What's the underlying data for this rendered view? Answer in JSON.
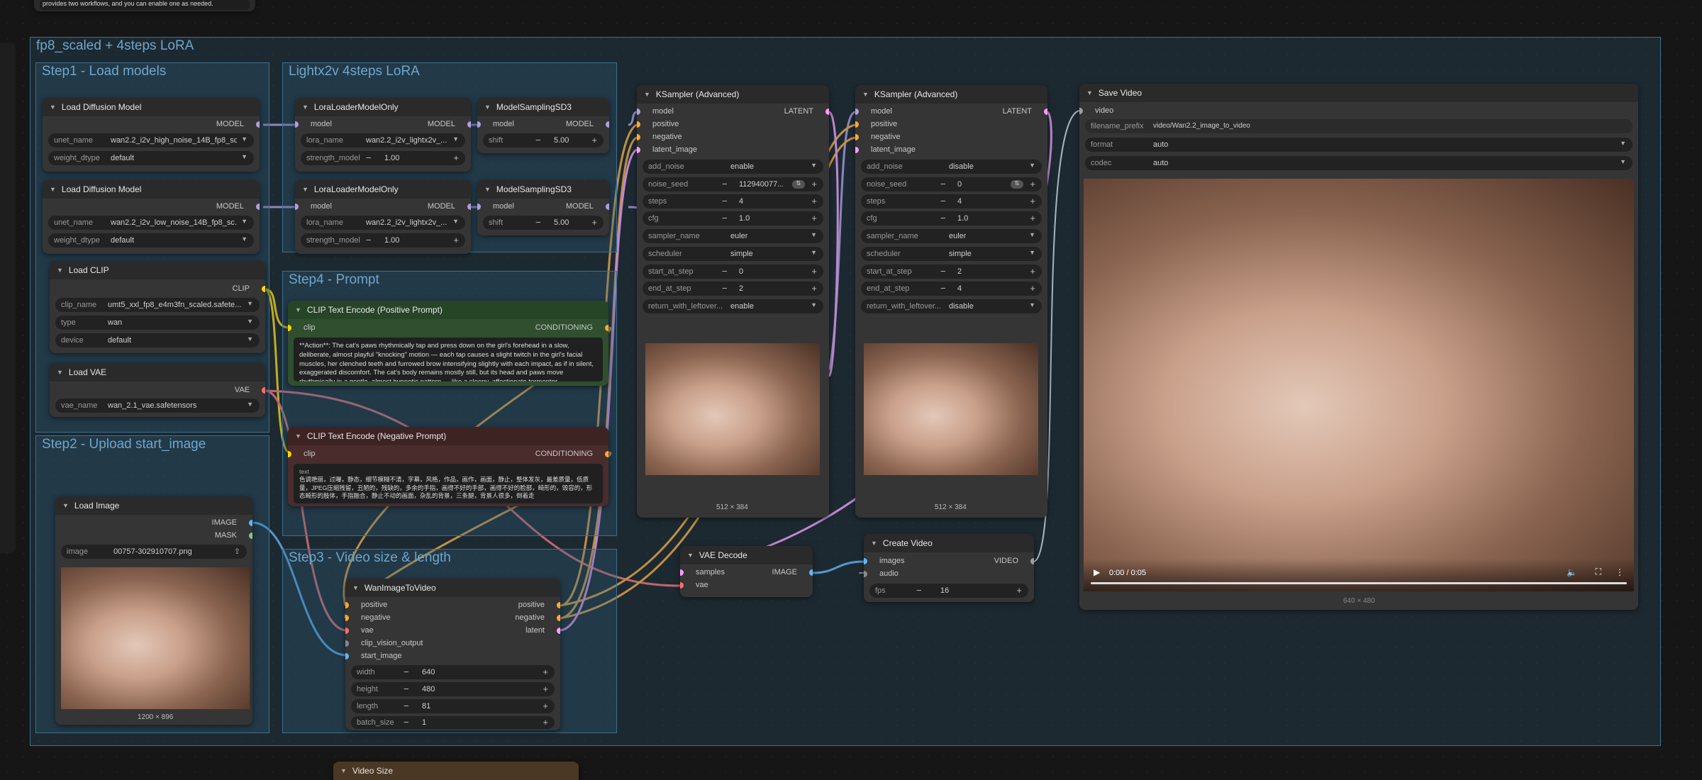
{
  "top_note": "provides two workflows, and you can enable one as needed.",
  "groups": {
    "main": "fp8_scaled +  4steps LoRA",
    "step1": "Step1 - Load models",
    "lightx": "Lightx2v 4steps LoRA",
    "step4": "Step4 - Prompt",
    "step2": "Step2 - Upload start_image",
    "step3": "Step3 - Video size & length"
  },
  "ldm1": {
    "title": "Load Diffusion Model",
    "out": "MODEL",
    "unet_label": "unet_name",
    "unet": "wan2.2_i2v_high_noise_14B_fp8_sc...",
    "wd_label": "weight_dtype",
    "wd": "default"
  },
  "ldm2": {
    "title": "Load Diffusion Model",
    "out": "MODEL",
    "unet_label": "unet_name",
    "unet": "wan2.2_i2v_low_noise_14B_fp8_sc...",
    "wd_label": "weight_dtype",
    "wd": "default"
  },
  "clip": {
    "title": "Load CLIP",
    "out": "CLIP",
    "name_label": "clip_name",
    "name": "umt5_xxl_fp8_e4m3fn_scaled.safete...",
    "type_label": "type",
    "type": "wan",
    "device_label": "device",
    "device": "default"
  },
  "vae": {
    "title": "Load VAE",
    "out": "VAE",
    "name_label": "vae_name",
    "name": "wan_2.1_vae.safetensors"
  },
  "lora1": {
    "title": "LoraLoaderModelOnly",
    "in": "model",
    "out": "MODEL",
    "name_label": "lora_name",
    "name": "wan2.2_i2v_lightx2v_...",
    "sm_label": "strength_model",
    "sm": "1.00"
  },
  "lora2": {
    "title": "LoraLoaderModelOnly",
    "in": "model",
    "out": "MODEL",
    "name_label": "lora_name",
    "name": "wan2.2_i2v_lightx2v_...",
    "sm_label": "strength_model",
    "sm": "1.00"
  },
  "msd1": {
    "title": "ModelSamplingSD3",
    "in": "model",
    "out": "MODEL",
    "shift_label": "shift",
    "shift": "5.00"
  },
  "msd2": {
    "title": "ModelSamplingSD3",
    "in": "model",
    "out": "MODEL",
    "shift_label": "shift",
    "shift": "5.00"
  },
  "pos": {
    "title": "CLIP Text Encode (Positive Prompt)",
    "in": "clip",
    "out": "CONDITIONING",
    "text": "**Action**: The cat's paws rhythmically tap and press down on the girl's forehead in a slow, deliberate, almost playful \"knocking\" motion — each tap causes a slight twitch in the girl's facial muscles, her clenched teeth and furrowed brow intensifying slightly with each impact, as if in silent, exaggerated discomfort. The cat's body remains mostly still, but its head and paws move rhythmically in a gentle, almost hypnotic pattern — like a sleepy, affectionate tormentor."
  },
  "neg": {
    "title": "CLIP Text Encode (Negative Prompt)",
    "in": "clip",
    "out": "CONDITIONING",
    "text_label": "text",
    "text": "色调艳丽，过曝，静态，细节模糊不清，字幕，风格，作品，画作，画面，静止，整体发灰，最差质量，低质量，JPEG压缩残留，丑陋的，残缺的，多余的手指，画得不好的手部，画得不好的脸部，畸形的，毁容的，形态畸形的肢体，手指融合，静止不动的画面，杂乱的背景，三条腿，背景人很多，倒着走"
  },
  "loadimg": {
    "title": "Load Image",
    "out_image": "IMAGE",
    "out_mask": "MASK",
    "image_label": "image",
    "image": "00757-302910707.png",
    "size": "1200 × 896"
  },
  "wan": {
    "title": "WanImageToVideo",
    "in_positive": "positive",
    "in_negative": "negative",
    "in_vae": "vae",
    "in_clipvis": "clip_vision_output",
    "in_start": "start_image",
    "out_positive": "positive",
    "out_negative": "negative",
    "out_latent": "latent",
    "width_label": "width",
    "width": "640",
    "height_label": "height",
    "height": "480",
    "length_label": "length",
    "length": "81",
    "batch_label": "batch_size",
    "batch": "1"
  },
  "ks1": {
    "title": "KSampler (Advanced)",
    "in_model": "model",
    "in_pos": "positive",
    "in_neg": "negative",
    "in_lat": "latent_image",
    "out": "LATENT",
    "add_noise_label": "add_noise",
    "add_noise": "enable",
    "seed_label": "noise_seed",
    "seed": "112940077...",
    "steps_label": "steps",
    "steps": "4",
    "cfg_label": "cfg",
    "cfg": "1.0",
    "sampler_label": "sampler_name",
    "sampler": "euler",
    "scheduler_label": "scheduler",
    "scheduler": "simple",
    "start_label": "start_at_step",
    "start": "0",
    "end_label": "end_at_step",
    "end": "2",
    "ret_label": "return_with_leftover...",
    "ret": "enable",
    "size": "512 × 384"
  },
  "ks2": {
    "title": "KSampler (Advanced)",
    "in_model": "model",
    "in_pos": "positive",
    "in_neg": "negative",
    "in_lat": "latent_image",
    "out": "LATENT",
    "add_noise_label": "add_noise",
    "add_noise": "disable",
    "seed_label": "noise_seed",
    "seed": "0",
    "steps_label": "steps",
    "steps": "4",
    "cfg_label": "cfg",
    "cfg": "1.0",
    "sampler_label": "sampler_name",
    "sampler": "euler",
    "scheduler_label": "scheduler",
    "scheduler": "simple",
    "start_label": "start_at_step",
    "start": "2",
    "end_label": "end_at_step",
    "end": "4",
    "ret_label": "return_with_leftover...",
    "ret": "disable",
    "size": "512 × 384"
  },
  "vaedec": {
    "title": "VAE Decode",
    "in_samples": "samples",
    "in_vae": "vae",
    "out": "IMAGE"
  },
  "createvid": {
    "title": "Create Video",
    "in_images": "images",
    "in_audio": "audio",
    "out": "VIDEO",
    "fps_label": "fps",
    "fps": "16"
  },
  "savevid": {
    "title": "Save Video",
    "in": "video",
    "prefix_label": "filename_prefix",
    "prefix": "video/Wan2.2_image_to_video",
    "format_label": "format",
    "format": "auto",
    "codec_label": "codec",
    "codec": "auto",
    "time": "0:00 / 0:05",
    "size": "640 × 480"
  },
  "videosize": {
    "title": "Video Size"
  },
  "colors": {
    "model": "#b39ddb",
    "clip": "#ffd500",
    "conditioning": "#ffa931",
    "vae": "#ff6e6e",
    "image": "#64b5f6",
    "mask": "#81c784",
    "latent": "#ff9cf9",
    "group": "#3d6f8e"
  }
}
